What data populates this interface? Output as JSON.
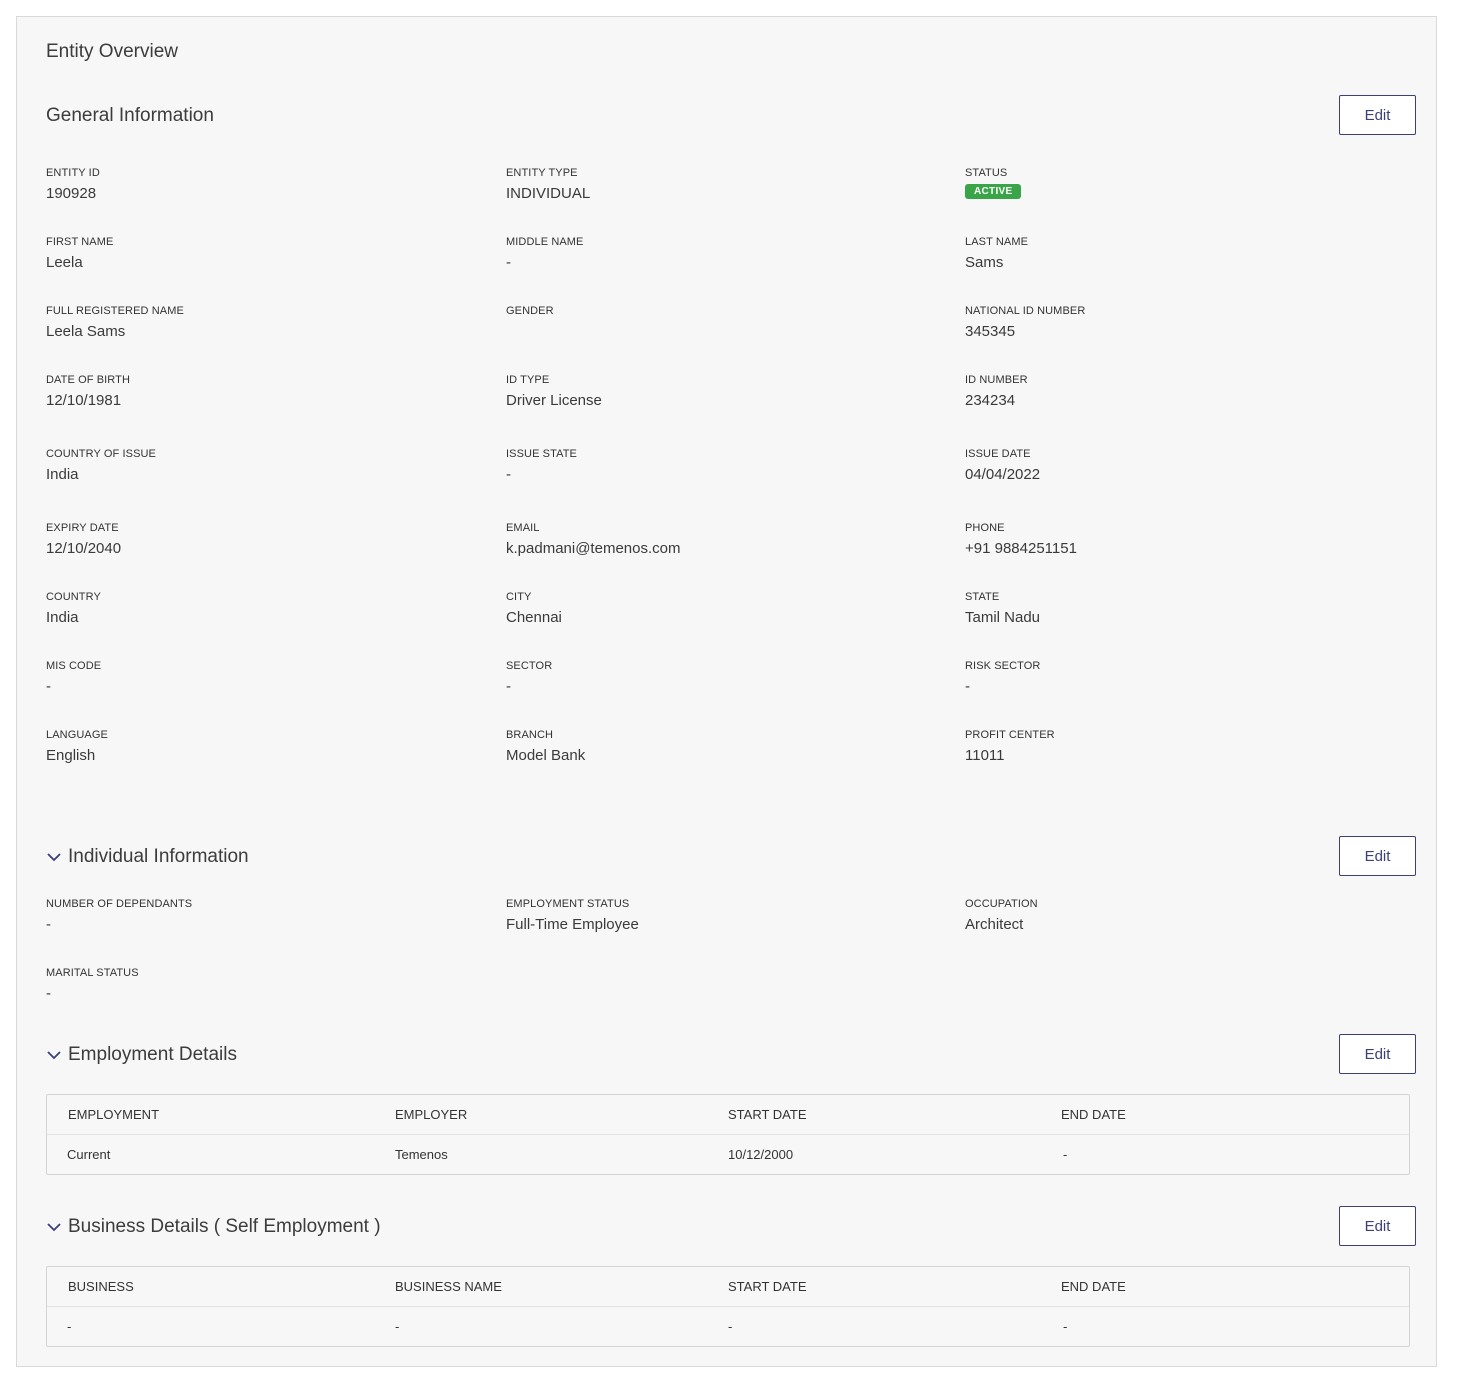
{
  "page_title": "Entity Overview",
  "general": {
    "title": "General Information",
    "edit_label": "Edit",
    "fields": [
      {
        "label": "ENTITY ID",
        "value": "190928"
      },
      {
        "label": "ENTITY TYPE",
        "value": "INDIVIDUAL"
      },
      {
        "label": "STATUS",
        "value": "ACTIVE"
      },
      {
        "label": "FIRST NAME",
        "value": "Leela"
      },
      {
        "label": "MIDDLE NAME",
        "value": "-"
      },
      {
        "label": "LAST NAME",
        "value": "Sams"
      },
      {
        "label": "FULL REGISTERED NAME",
        "value": "Leela Sams"
      },
      {
        "label": "GENDER",
        "value": ""
      },
      {
        "label": "NATIONAL ID NUMBER",
        "value": "345345"
      },
      {
        "label": "DATE OF BIRTH",
        "value": "12/10/1981"
      },
      {
        "label": "ID TYPE",
        "value": "Driver License"
      },
      {
        "label": "ID NUMBER",
        "value": "234234"
      },
      {
        "label": "COUNTRY OF ISSUE",
        "value": "India"
      },
      {
        "label": "ISSUE STATE",
        "value": "-"
      },
      {
        "label": "ISSUE DATE",
        "value": "04/04/2022"
      },
      {
        "label": "EXPIRY DATE",
        "value": "12/10/2040"
      },
      {
        "label": "EMAIL",
        "value": "k.padmani@temenos.com"
      },
      {
        "label": "PHONE",
        "value": "+91 9884251151"
      },
      {
        "label": "COUNTRY",
        "value": "India"
      },
      {
        "label": "CITY",
        "value": "Chennai"
      },
      {
        "label": "STATE",
        "value": "Tamil Nadu"
      },
      {
        "label": "MIS CODE",
        "value": "-"
      },
      {
        "label": "SECTOR",
        "value": "-"
      },
      {
        "label": "RISK SECTOR",
        "value": "-"
      },
      {
        "label": "LANGUAGE",
        "value": "English"
      },
      {
        "label": "BRANCH",
        "value": "Model Bank"
      },
      {
        "label": "PROFIT CENTER",
        "value": "11011"
      }
    ]
  },
  "individual": {
    "title": "Individual Information",
    "edit_label": "Edit",
    "fields": [
      {
        "label": "NUMBER OF DEPENDANTS",
        "value": "-"
      },
      {
        "label": "EMPLOYMENT STATUS",
        "value": "Full-Time Employee"
      },
      {
        "label": "OCCUPATION",
        "value": "Architect"
      },
      {
        "label": "MARITAL STATUS",
        "value": "-"
      }
    ]
  },
  "employment": {
    "title": "Employment Details",
    "edit_label": "Edit",
    "columns": [
      "EMPLOYMENT",
      "EMPLOYER",
      "START DATE",
      "END DATE"
    ],
    "rows": [
      [
        "Current",
        "Temenos",
        "10/12/2000",
        "-"
      ]
    ]
  },
  "business": {
    "title": "Business Details ( Self Employment )",
    "edit_label": "Edit",
    "columns": [
      "BUSINESS",
      "BUSINESS NAME",
      "START DATE",
      "END DATE"
    ],
    "rows": [
      [
        "-",
        "-",
        "-",
        "-"
      ]
    ]
  },
  "colors": {
    "accent": "#3b3f7a",
    "status_active": "#3aa548"
  },
  "icons": {
    "collapse": "chevron-down-icon"
  }
}
